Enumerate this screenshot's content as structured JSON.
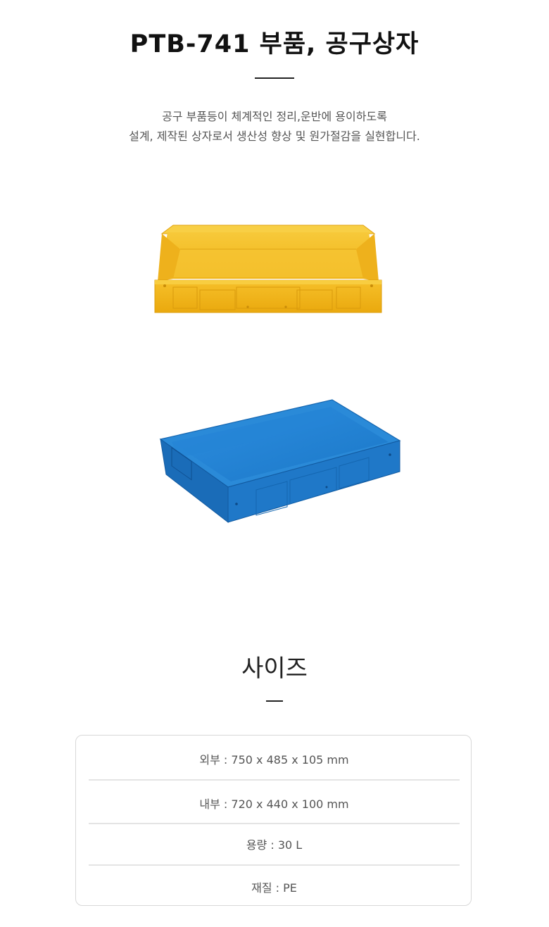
{
  "header": {
    "title": "PTB-741 부품, 공구상자",
    "description_lines": [
      "공구 부품등이 체계적인 정리,운반에 용이하도록",
      "설계, 제작된 상자로서 생산성 향상 및 원가절감을 실현합니다."
    ]
  },
  "products": [
    {
      "name": "yellow-tray",
      "color": "#f2b81a"
    },
    {
      "name": "blue-tray",
      "color": "#1e7fd0"
    }
  ],
  "size_section": {
    "heading": "사이즈",
    "specs": [
      "외부 : 750 x 485 x 105 mm",
      "내부 : 720 x 440 x 100 mm",
      "용량 : 30 L",
      "재질 : PE"
    ]
  }
}
